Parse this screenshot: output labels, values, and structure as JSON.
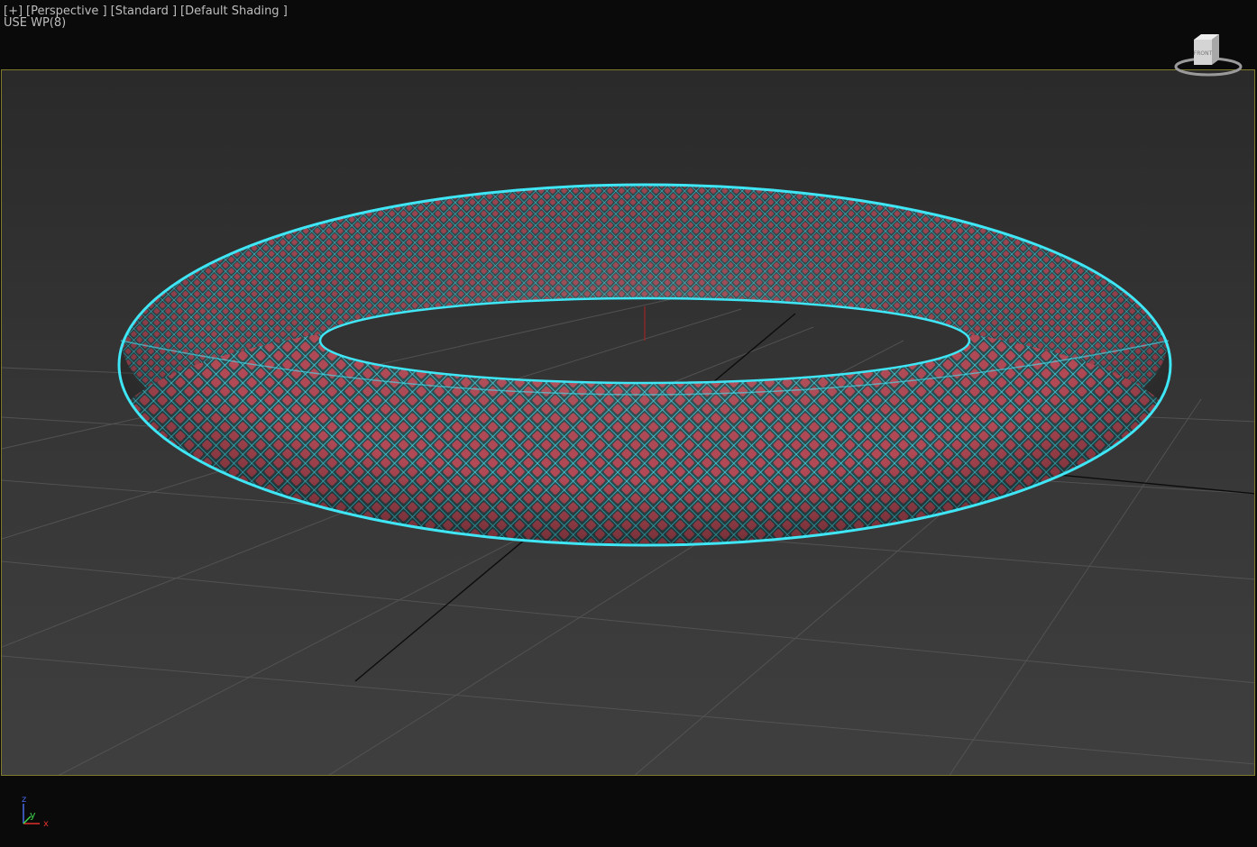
{
  "viewport": {
    "menu": {
      "plus": "[+]",
      "view": "[Perspective ]",
      "style": "[Standard ]",
      "shading": "[Default Shading ]"
    },
    "status": "USE WP(8)",
    "viewcube_label": "FRONT",
    "axis_labels": {
      "z": "z",
      "y": "y",
      "x": "x"
    },
    "colors": {
      "frame_border": "#807a2c",
      "mesh_highlight": "#3fe6f5",
      "mesh_cells": "#b24a56",
      "mesh_body": "#3e5a5e",
      "axis_x": "#e0302a",
      "axis_y": "#3bd34a",
      "axis_z": "#4a6ae8"
    },
    "icons": [
      "viewcube-icon",
      "axis-tripod-icon"
    ]
  }
}
